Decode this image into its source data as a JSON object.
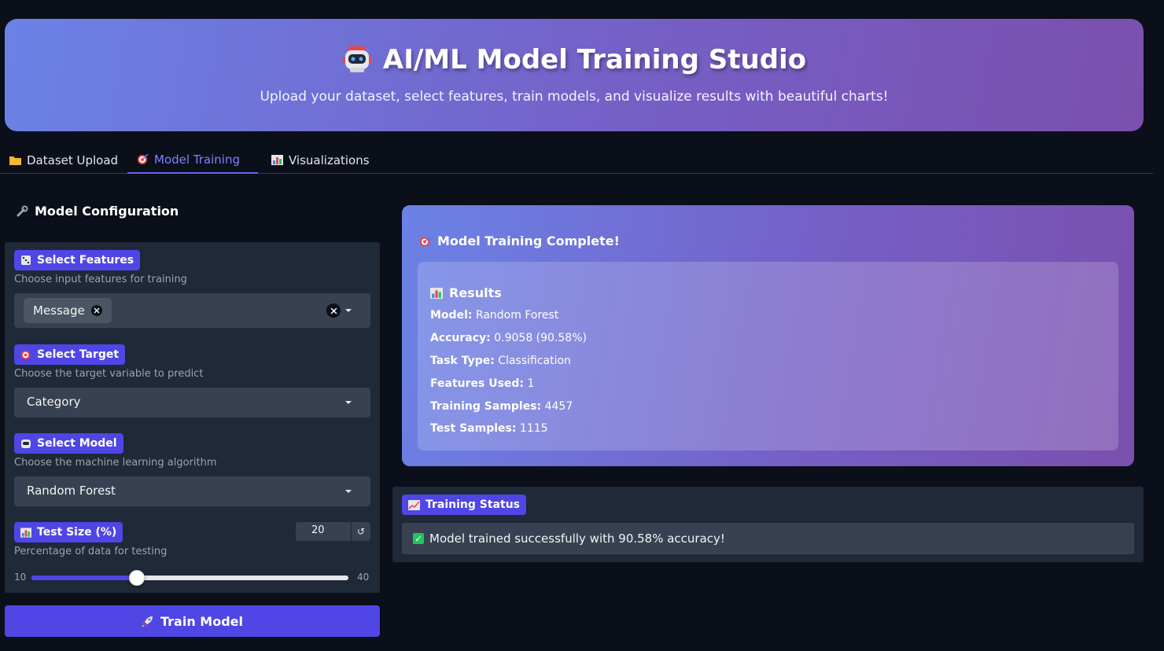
{
  "header": {
    "title": "AI/ML Model Training Studio",
    "subtitle": "Upload your dataset, select features, train models, and visualize results with beautiful charts!",
    "icon": "robot-icon"
  },
  "tabs": [
    {
      "label": "Dataset Upload",
      "icon": "folder-icon",
      "active": false
    },
    {
      "label": "Model Training",
      "icon": "target-icon",
      "active": true
    },
    {
      "label": "Visualizations",
      "icon": "bar-chart-icon",
      "active": false
    }
  ],
  "config": {
    "title": "Model Configuration",
    "features": {
      "label": "Select Features",
      "hint": "Choose input features for training",
      "selected": [
        "Message"
      ]
    },
    "target": {
      "label": "Select Target",
      "hint": "Choose the target variable to predict",
      "value": "Category"
    },
    "model": {
      "label": "Select Model",
      "hint": "Choose the machine learning algorithm",
      "value": "Random Forest"
    },
    "test_size": {
      "label": "Test Size (%)",
      "hint": "Percentage of data for testing",
      "value": "20",
      "min": "10",
      "max": "40",
      "value_num": 20,
      "min_num": 10,
      "max_num": 40
    },
    "train_button": "Train Model"
  },
  "results": {
    "title": "Model Training Complete!",
    "heading": "Results",
    "lines": [
      {
        "key": "Model:",
        "value": "Random Forest"
      },
      {
        "key": "Accuracy:",
        "value": "0.9058 (90.58%)"
      },
      {
        "key": "Task Type:",
        "value": "Classification"
      },
      {
        "key": "Features Used:",
        "value": "1"
      },
      {
        "key": "Training Samples:",
        "value": "4457"
      },
      {
        "key": "Test Samples:",
        "value": "1115"
      }
    ]
  },
  "status": {
    "label": "Training Status",
    "message": "Model trained successfully with 90.58% accuracy!"
  },
  "colors": {
    "accent": "#4f46e5",
    "background": "#0b0f19",
    "panel": "#1f2937",
    "success": "#22c55e"
  }
}
